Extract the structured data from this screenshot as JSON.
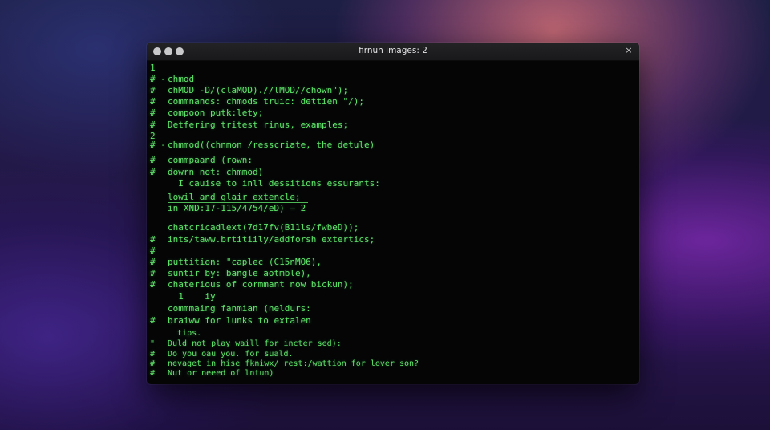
{
  "window": {
    "title": "firnun images: 2",
    "close_glyph": "×"
  },
  "lines": [
    {
      "mark": "1",
      "text": ""
    },
    {
      "mark": "# -",
      "text": "chmod"
    },
    {
      "mark": "#",
      "text": "chMOD -D/(claMOD).//lMOD//chown\");"
    },
    {
      "mark": "#",
      "text": "commnands: chmods truic: dettien \"/);"
    },
    {
      "mark": "#",
      "text": "compoon putk:lety;"
    },
    {
      "mark": "#",
      "text": "Detfering tritest rinus, examples;"
    },
    {
      "mark": "2",
      "text": ""
    },
    {
      "mark": "# -",
      "text": "chmmod((chnmon /resscriate, the detule)"
    },
    {
      "mark": "#",
      "text": "commpaand (rown:"
    },
    {
      "mark": "#",
      "text": "dowrn not: chmmod)"
    },
    {
      "mark": "",
      "text": "  I cauise to inll dessitions essurants:"
    },
    {
      "mark": "",
      "text": "lowil and glair extencle;"
    },
    {
      "mark": "",
      "text": "in XND:17-115/4754/eD) — 2"
    },
    {
      "mark": "",
      "text": "chatcricadlext(7d17fv(B11ls/fwbeD));"
    },
    {
      "mark": "#",
      "text": "ints/taww.brtitiily/addforsh extertics;"
    },
    {
      "mark": "#",
      "text": ""
    },
    {
      "mark": "#",
      "text": "puttition: \"caplec (C15nMO6),"
    },
    {
      "mark": "#",
      "text": "suntir by: bangle aotmble),"
    },
    {
      "mark": "#",
      "text": "chaterious of cormmant now bickun);"
    },
    {
      "mark": "",
      "text": "  1    iy"
    },
    {
      "mark": "",
      "text": "commmaing fanmian (neldurs:"
    },
    {
      "mark": "#",
      "text": "braiww for lunks to extalen"
    },
    {
      "mark": "",
      "text": "  tips."
    },
    {
      "mark": "\"",
      "text": "Duld not play waill for incter sed):"
    },
    {
      "mark": "#",
      "text": "Do you oau you. for suald."
    },
    {
      "mark": "#",
      "text": "nevaget in hise fkniwx/ rest:/wattion for lover son?"
    },
    {
      "mark": "#",
      "text": "Nut or neeed of lntun)"
    }
  ]
}
